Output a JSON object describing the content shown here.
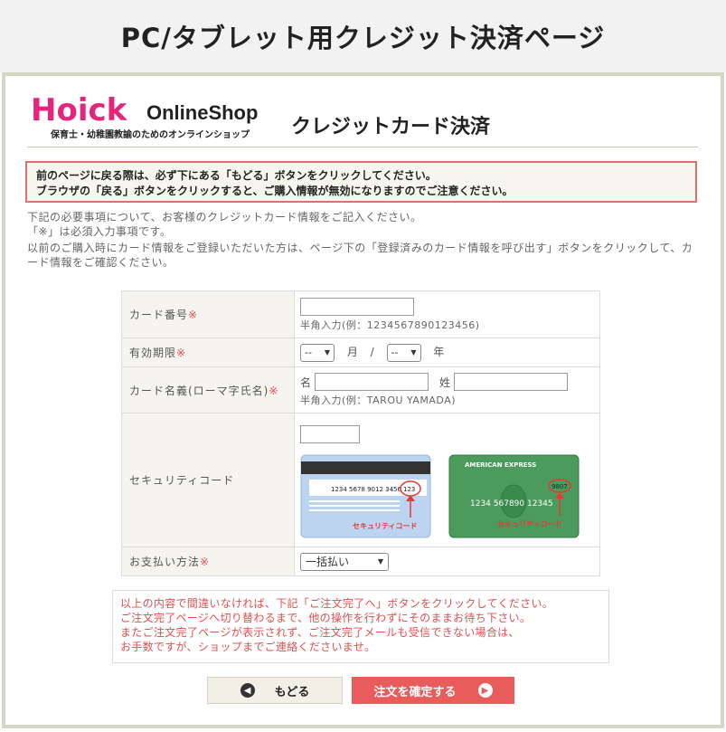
{
  "page_banner_title": "PC/タブレット用クレジット決済ページ",
  "header": {
    "logo_wordmark": "Hoick",
    "logo_text": "OnlineShop",
    "logo_sub": "保育士・幼稚園教諭のためのオンラインショップ",
    "page_heading": "クレジットカード決済"
  },
  "warning": {
    "line1": "前のページに戻る際は、必ず下にある「もどる」ボタンをクリックしてください。",
    "line2": "ブラウザの「戻る」ボタンをクリックすると、ご購入情報が無効になりますのでご注意ください。"
  },
  "intro": {
    "line1": "下記の必要事項について、お客様のクレジットカード情報をご記入ください。",
    "line2": "「※」は必須入力事項です。",
    "line3": "以前のご購入時にカード情報をご登録いただいた方は、ページ下の「登録済みのカード情報を呼び出す」ボタンをクリックして、カード情報をご確認ください。"
  },
  "form": {
    "required_mark": "※",
    "card_number_label": "カード番号",
    "card_number_hint": "半角入力(例：1234567890123456)",
    "expiry_label": "有効期限",
    "expiry_month_value": "--",
    "expiry_month_unit": "月",
    "expiry_separator": "/",
    "expiry_year_value": "--",
    "expiry_year_unit": "年",
    "card_name_label": "カード名義(ローマ字氏名)",
    "first_name_label": "名",
    "last_name_label": "姓",
    "card_name_hint": "半角入力(例：TAROU YAMADA)",
    "security_label": "セキュリティコード",
    "payment_label": "お支払い方法",
    "payment_value": "一括払い"
  },
  "cards": {
    "visa_number": "1234 5678 9012 3456",
    "visa_code": "123",
    "visa_caption": "セキュリティコード",
    "amex_brand": "AMERICAN EXPRESS",
    "amex_number": "1234 567890 12345",
    "amex_code": "9807",
    "amex_caption": "セキュリティコード"
  },
  "notice": {
    "line1": "以上の内容で間違いなければ、下記「ご注文完了へ」ボタンをクリックしてください。",
    "line2": "ご注文完了ページへ切り替わるまで、他の操作を行わずにそのままお待ち下さい。",
    "line3": "またご注文完了ページが表示されず、ご注文完了メールも受信できない場合は、",
    "line4": "お手数ですが、ショップまでご連絡くださいませ。"
  },
  "buttons": {
    "back_label": "もどる",
    "confirm_label": "注文を確定する"
  },
  "colors": {
    "accent_red": "#e85c5c",
    "required_red": "#e05050",
    "label_bg": "#f5f4ef",
    "frame_border": "#d6d6c4"
  }
}
